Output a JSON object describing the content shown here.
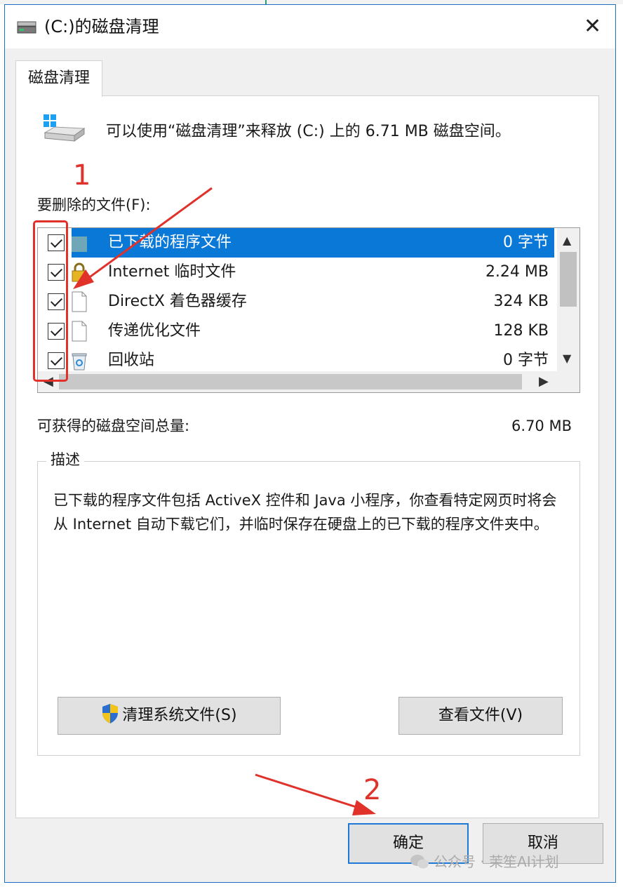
{
  "window": {
    "title": "(C:)的磁盘清理",
    "close_glyph": "✕"
  },
  "tab": {
    "label": "磁盘清理"
  },
  "intro": "可以使用“磁盘清理”来释放 (C:) 上的 6.71 MB 磁盘空间。",
  "files_label": "要删除的文件(F):",
  "files": [
    {
      "name": "已下载的程序文件",
      "size": "0 字节",
      "checked": true,
      "selected": true,
      "icon": "folder-icon"
    },
    {
      "name": "Internet 临时文件",
      "size": "2.24 MB",
      "checked": true,
      "selected": false,
      "icon": "lock-icon"
    },
    {
      "name": "DirectX 着色器缓存",
      "size": "324 KB",
      "checked": true,
      "selected": false,
      "icon": "file-icon"
    },
    {
      "name": "传递优化文件",
      "size": "128 KB",
      "checked": true,
      "selected": false,
      "icon": "file-icon"
    },
    {
      "name": "回收站",
      "size": "0 字节",
      "checked": true,
      "selected": false,
      "icon": "recycle-bin-icon"
    }
  ],
  "total": {
    "label": "可获得的磁盘空间总量:",
    "value": "6.70 MB"
  },
  "description": {
    "legend": "描述",
    "text": "已下载的程序文件包括 ActiveX 控件和 Java 小程序，你查看特定网页时将会从 Internet 自动下载它们，并临时保存在硬盘上的已下载的程序文件夹中。"
  },
  "buttons": {
    "clean_system": "清理系统文件(S)",
    "view_files": "查看文件(V)",
    "ok": "确定",
    "cancel": "取消"
  },
  "annotations": {
    "step1": "1",
    "step2": "2"
  },
  "watermark": "公众号 · 茉笙AI计划",
  "colors": {
    "selection": "#0a78d7",
    "annotation_red": "#e0312a",
    "focus_border": "#1e78d6"
  }
}
